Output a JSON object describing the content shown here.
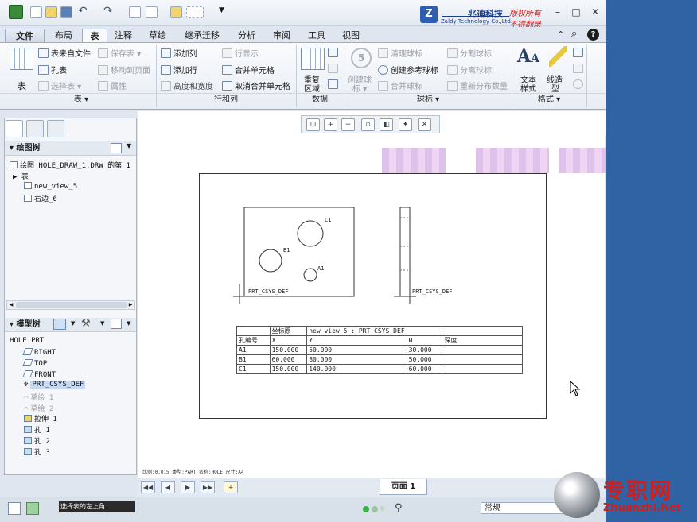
{
  "title_bar": {
    "company_logo": "Z",
    "company_name": "兆迪科技",
    "company_en": "Zaldy Technology Co.,Ltd.",
    "copyright_1": "版权所有",
    "copyright_2": "不得翻录"
  },
  "tabs": [
    "文件",
    "布局",
    "表",
    "注释",
    "草绘",
    "继承迁移",
    "分析",
    "审阅",
    "工具",
    "视图"
  ],
  "ribbon": {
    "table": {
      "big": "表",
      "items": [
        "表来自文件",
        "保存表",
        "孔表",
        "移动到页面",
        "选择表",
        "属性"
      ],
      "group": "表"
    },
    "rows_cols": {
      "items": [
        "添加列",
        "行显示",
        "添加行",
        "合并单元格",
        "高度和宽度",
        "取消合并单元格"
      ],
      "group": "行和列"
    },
    "data": {
      "big1": "重复",
      "big2": "区域",
      "group": "数据"
    },
    "balloons": {
      "create1": "创建球",
      "create2": "标",
      "items": [
        "清理球标",
        "分割球标",
        "创建参考球标",
        "分离球标",
        "合并球标",
        "重新分布数量"
      ],
      "group": "球标"
    },
    "format": {
      "text_style1": "文本",
      "text_style2": "样式",
      "line_style1": "线造",
      "line_style2": "型",
      "group": "格式"
    }
  },
  "drawing_tree": {
    "header": "绘图树",
    "items": [
      "绘图 HOLE_DRAW_1.DRW 的第 1",
      "表",
      "new_view_5",
      "右边_6"
    ]
  },
  "model_tree": {
    "header": "模型树",
    "root": "HOLE.PRT",
    "items": [
      "RIGHT",
      "TOP",
      "FRONT",
      "PRT_CSYS_DEF",
      "草绘 1",
      "草绘 2",
      "拉伸 1",
      "孔 1",
      "孔 2",
      "孔 3"
    ]
  },
  "drawing": {
    "labels": [
      "C1",
      "B1",
      "A1"
    ],
    "csys1": "PRT_CSYS_DEF",
    "csys2": "PRT_CSYS_DEF",
    "table_rows": [
      [
        "",
        "坐标原",
        "new_view_5 : PRT_CSYS_DEF",
        "",
        ""
      ],
      [
        "孔编号",
        "X",
        "Y",
        "Ø",
        "深度"
      ],
      [
        "A1",
        "150.000",
        "50.000",
        "30.000",
        ""
      ],
      [
        "B1",
        "60.000",
        "80.000",
        "50.000",
        ""
      ],
      [
        "C1",
        "150.000",
        "140.000",
        "60.000",
        ""
      ]
    ]
  },
  "status_line": "比例:0.015   类型:PART   名称:HOLE   尺寸:A4",
  "page_tab": "页面 1",
  "message": "选择表的左上角",
  "filter_value": "常规",
  "watermark": {
    "cn": "专职网",
    "en": "Zhuanzhi.Net"
  }
}
